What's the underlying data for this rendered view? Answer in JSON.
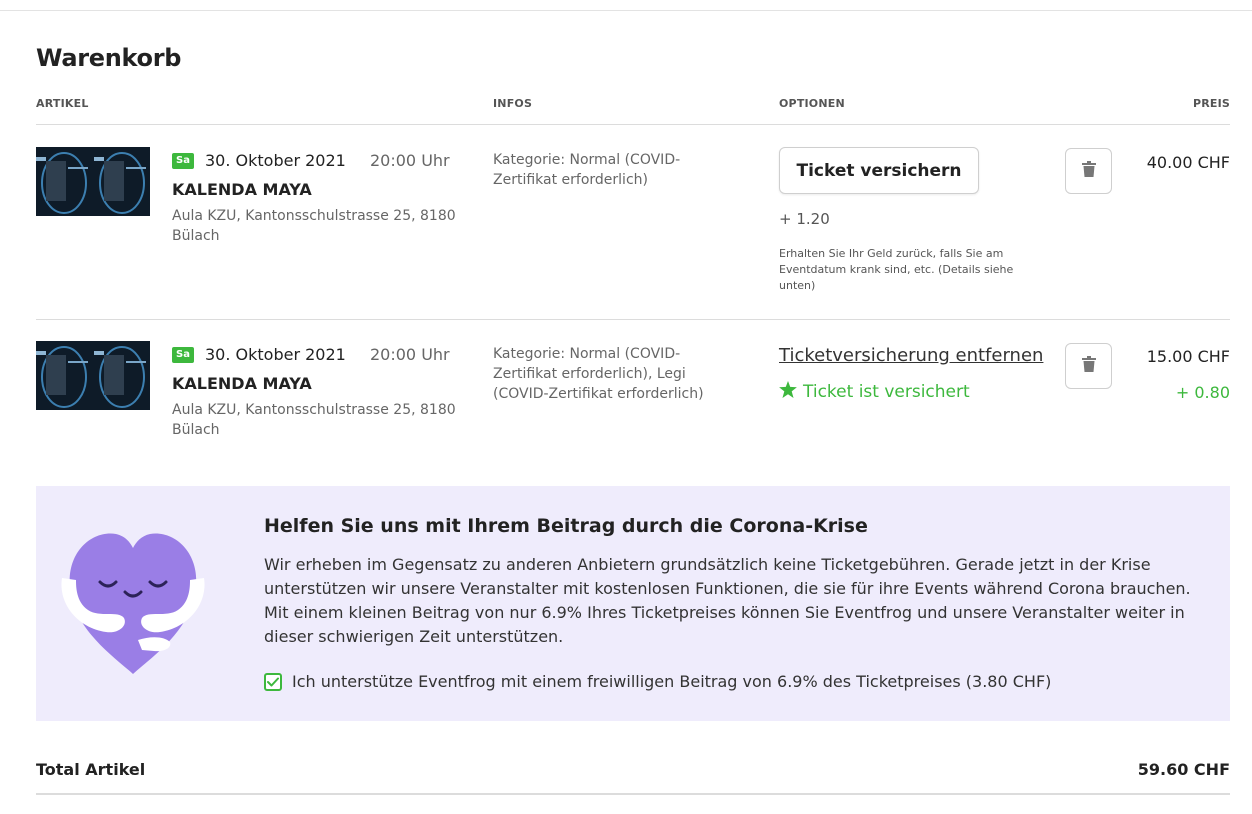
{
  "cart": {
    "title": "Warenkorb",
    "columns": {
      "article": "ARTIKEL",
      "infos": "INFOS",
      "options": "OPTIONEN",
      "price": "PREIS"
    }
  },
  "items": [
    {
      "day_badge": "Sa",
      "date": "30. Oktober 2021",
      "time": "20:00 Uhr",
      "event_title": "KALENDA MAYA",
      "venue": "Aula KZU, Kantonsschulstrasse 25, 8180 Bülach",
      "infos": "Kategorie: Normal (COVID-Zertifikat erforderlich)",
      "insure_button": "Ticket versichern",
      "insurance_price": "+ 1.20",
      "insurance_note": "Erhalten Sie Ihr Geld zurück, falls Sie am Eventdatum krank sind, etc. (Details siehe unten)",
      "price": "40.00 CHF"
    },
    {
      "day_badge": "Sa",
      "date": "30. Oktober 2021",
      "time": "20:00 Uhr",
      "event_title": "KALENDA MAYA",
      "venue": "Aula KZU, Kantonsschulstrasse 25, 8180 Bülach",
      "infos": "Kategorie: Normal (COVID-Zertifikat erforderlich), Legi (COVID-Zertifikat erforderlich)",
      "remove_insurance_link": "Ticketversicherung entfernen",
      "insured_status": "Ticket ist versichert",
      "price": "15.00 CHF",
      "insurance_addon": "+ 0.80"
    }
  ],
  "donation": {
    "title": "Helfen Sie uns mit Ihrem Beitrag durch die Corona-Krise",
    "text": "Wir erheben im Gegensatz zu anderen Anbietern grundsätzlich keine Ticketgebühren. Gerade jetzt in der Krise unterstützen wir unsere Veranstalter mit kostenlosen Funktionen, die sie für ihre Events während Corona brauchen. Mit einem kleinen Beitrag von nur 6.9% Ihres Ticketpreises können Sie Eventfrog und unsere Veranstalter weiter in dieser schwierigen Zeit unterstützen.",
    "checkbox_label": "Ich unterstütze Eventfrog mit einem freiwilligen Beitrag von 6.9% des Ticketpreises (3.80 CHF)",
    "checked": true
  },
  "total": {
    "label": "Total Artikel",
    "value": "59.60 CHF"
  },
  "colors": {
    "accent_green": "#3db83d",
    "donation_bg": "#efecfc",
    "heart_purple": "#9a7ee6"
  },
  "icons": {
    "trash": "trash-icon",
    "star": "star-icon",
    "check": "checkmark-icon",
    "heart": "hugging-heart-icon"
  }
}
